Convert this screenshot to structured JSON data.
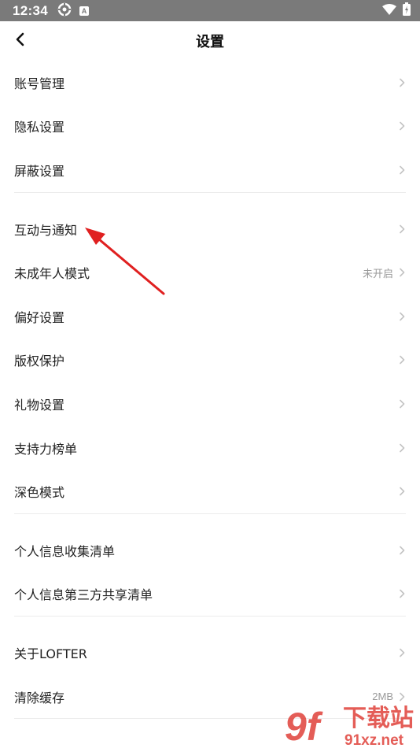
{
  "status_bar": {
    "time": "12:34",
    "badge": "A"
  },
  "header": {
    "title": "设置"
  },
  "sections": [
    {
      "items": [
        {
          "label": "账号管理",
          "value": ""
        },
        {
          "label": "隐私设置",
          "value": ""
        },
        {
          "label": "屏蔽设置",
          "value": ""
        }
      ]
    },
    {
      "items": [
        {
          "label": "互动与通知",
          "value": ""
        },
        {
          "label": "未成年人模式",
          "value": "未开启"
        },
        {
          "label": "偏好设置",
          "value": ""
        },
        {
          "label": "版权保护",
          "value": ""
        },
        {
          "label": "礼物设置",
          "value": ""
        },
        {
          "label": "支持力榜单",
          "value": ""
        },
        {
          "label": "深色模式",
          "value": ""
        }
      ]
    },
    {
      "items": [
        {
          "label": "个人信息收集清单",
          "value": ""
        },
        {
          "label": "个人信息第三方共享清单",
          "value": ""
        }
      ]
    },
    {
      "items": [
        {
          "label": "关于LOFTER",
          "value": ""
        },
        {
          "label": "清除缓存",
          "value": "2MB"
        }
      ]
    }
  ],
  "annotation": {
    "arrow_color": "#e02020"
  },
  "watermark": {
    "logo_text": "9f",
    "title": "下载站",
    "domain": "91xz.net",
    "color": "#e0413a"
  }
}
